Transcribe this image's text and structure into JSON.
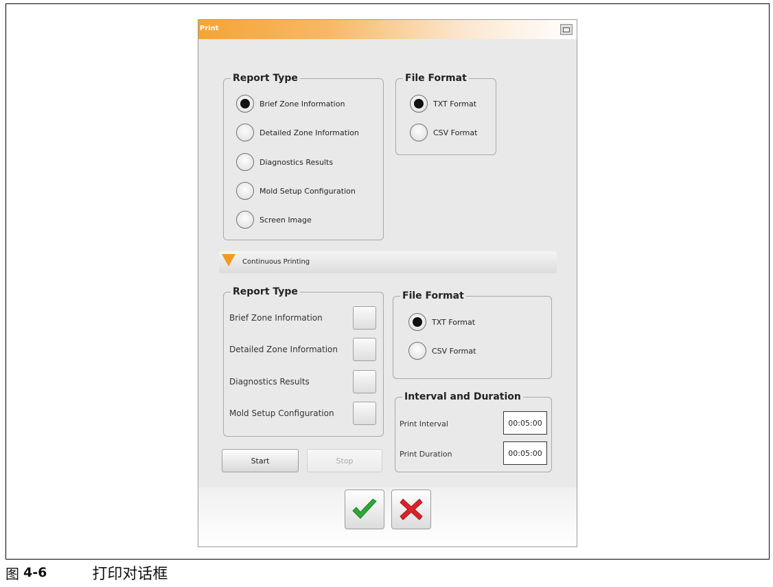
{
  "dialog": {
    "title": "Print",
    "report_type_1": {
      "legend": "Report Type",
      "options": [
        {
          "label": "Brief Zone Information",
          "selected": true
        },
        {
          "label": "Detailed Zone Information",
          "selected": false
        },
        {
          "label": "Diagnostics Results",
          "selected": false
        },
        {
          "label": "Mold Setup Configuration",
          "selected": false
        },
        {
          "label": "Screen Image",
          "selected": false
        }
      ]
    },
    "file_format_1": {
      "legend": "File Format",
      "options": [
        {
          "label": "TXT Format",
          "selected": true
        },
        {
          "label": "CSV Format",
          "selected": false
        }
      ]
    },
    "continuous_printing": {
      "label": "Continuous Printing"
    },
    "report_type_2": {
      "legend": "Report Type",
      "items": [
        {
          "label": "Brief Zone Information"
        },
        {
          "label": "Detailed Zone Information"
        },
        {
          "label": "Diagnostics Results"
        },
        {
          "label": "Mold Setup Configuration"
        }
      ]
    },
    "file_format_2": {
      "legend": "File Format",
      "options": [
        {
          "label": "TXT Format",
          "selected": true
        },
        {
          "label": "CSV Format",
          "selected": false
        }
      ]
    },
    "interval": {
      "legend": "Interval and Duration",
      "print_interval_label": "Print Interval",
      "print_interval_value": "00:05:00",
      "print_duration_label": "Print Duration",
      "print_duration_value": "00:05:00"
    },
    "buttons": {
      "start": "Start",
      "stop": "Stop"
    },
    "colors": {
      "accent": "#f39a22",
      "ok": "#2ea836",
      "cancel": "#d8232a"
    }
  },
  "caption": {
    "figure": "图",
    "number": "4-6",
    "title": "打印对话框"
  }
}
